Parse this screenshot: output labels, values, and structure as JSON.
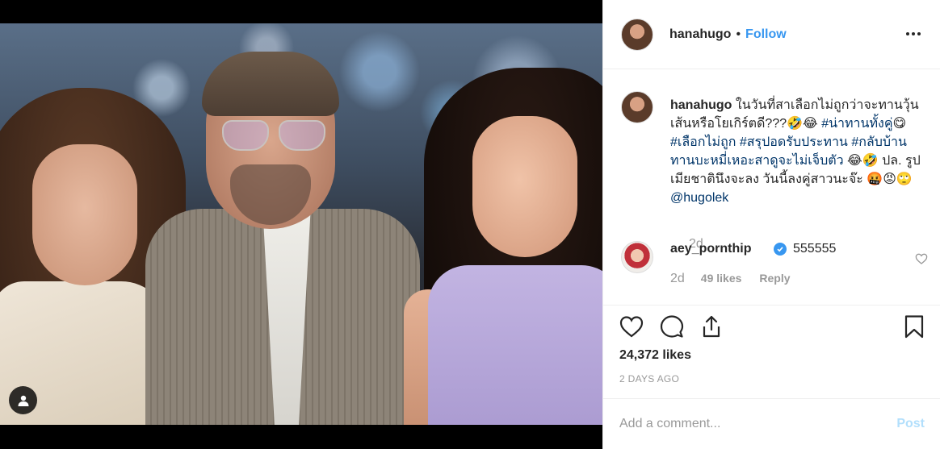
{
  "post": {
    "username": "hanahugo",
    "separator": "•",
    "follow_label": "Follow",
    "caption": {
      "username": "hanahugo",
      "text_part1": "ในวันที่สาเลือกไม่ถูกว่าจะทานวุ้นเส้นหรือโยเกิร์ตดี???🤣😂 ",
      "hashtag1": "#น่าทานทั้งคู่",
      "text_part2": "😋 ",
      "hashtag2": "#เลือกไม่ถูก",
      "hashtag3": "#สรุปอดรับประทาน",
      "hashtag4": "#กลับบ้านทานบะหมี่เหอะสาดูจะไม่เจ็บตัว",
      "text_part3": " 😂🤣 ปล. รูปเมียชาตินึงจะลง วันนี้ลงคู่สาวนะจ๊ะ 🤬😡🙄 ",
      "mention": "@hugolek",
      "time": "2d"
    },
    "comment": {
      "username": "aey_pornthip",
      "text": "555555",
      "time": "2d",
      "likes": "49 likes",
      "reply_label": "Reply"
    },
    "likes_count": "24,372 likes",
    "date": "2 DAYS AGO",
    "add_comment_placeholder": "Add a comment...",
    "post_label": "Post"
  },
  "colors": {
    "link_blue": "#3897f0",
    "hashtag_blue": "#003569",
    "post_disabled": "#b2dffc",
    "muted": "#999999"
  },
  "icons": {
    "tag": "user-tag-icon",
    "more": "more-options-icon",
    "verified": "verified-badge-icon",
    "like": "heart-icon",
    "comment": "comment-icon",
    "share": "share-icon",
    "save": "bookmark-icon"
  }
}
